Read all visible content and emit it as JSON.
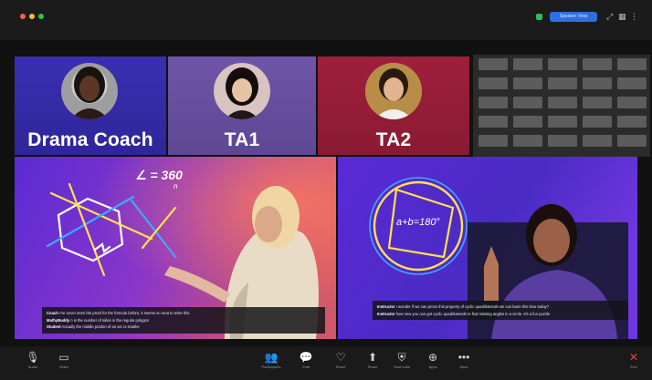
{
  "window": {
    "traffic_colors": [
      "#ff5f57",
      "#febc2e",
      "#28c840"
    ],
    "view_button_label": "Speaker View",
    "security_color": "#23c25a"
  },
  "gallery": {
    "tiles": [
      {
        "name": "Drama Coach",
        "bg": "#3b2fb0"
      },
      {
        "name": "TA1",
        "bg": "#6e53a3"
      },
      {
        "name": "TA2",
        "bg": "#9c1f3a"
      }
    ]
  },
  "stage": {
    "left": {
      "math_text": "∠ = 360",
      "math_denominator": "n",
      "captions": [
        {
          "speaker": "Coach",
          "text": "I've never seen the proof for the formula before, it seems so neat to write this."
        },
        {
          "speaker": "MathyBuddy",
          "text": "n is the number of sides in the regular polygon"
        },
        {
          "speaker": "Student",
          "text": "Actually the middle portion of an arc is smaller"
        }
      ]
    },
    "right": {
      "math_text": "a+b=180°",
      "captions": [
        {
          "speaker": "Instructor",
          "text": "I wonder if we can prove this property of cyclic quadrilaterals we can learn this time today?"
        },
        {
          "speaker": "Instructor",
          "text": "how now you can get cyclic quadrilaterals to find missing angles in a circle. It's a fun puzzle"
        }
      ]
    }
  },
  "toolbar": {
    "left": [
      {
        "label": "Audio",
        "icon": "microphone-icon"
      },
      {
        "label": "Video",
        "icon": "video-camera-icon"
      }
    ],
    "center": [
      {
        "label": "Participants",
        "icon": "participants-icon"
      },
      {
        "label": "Chat",
        "icon": "chat-icon"
      },
      {
        "label": "React",
        "icon": "react-icon"
      },
      {
        "label": "Share",
        "icon": "share-screen-icon"
      },
      {
        "label": "Host tools",
        "icon": "host-tools-icon"
      },
      {
        "label": "Apps",
        "icon": "apps-icon"
      },
      {
        "label": "More",
        "icon": "more-icon"
      }
    ],
    "right": [
      {
        "label": "End",
        "icon": "end-call-icon"
      }
    ]
  }
}
